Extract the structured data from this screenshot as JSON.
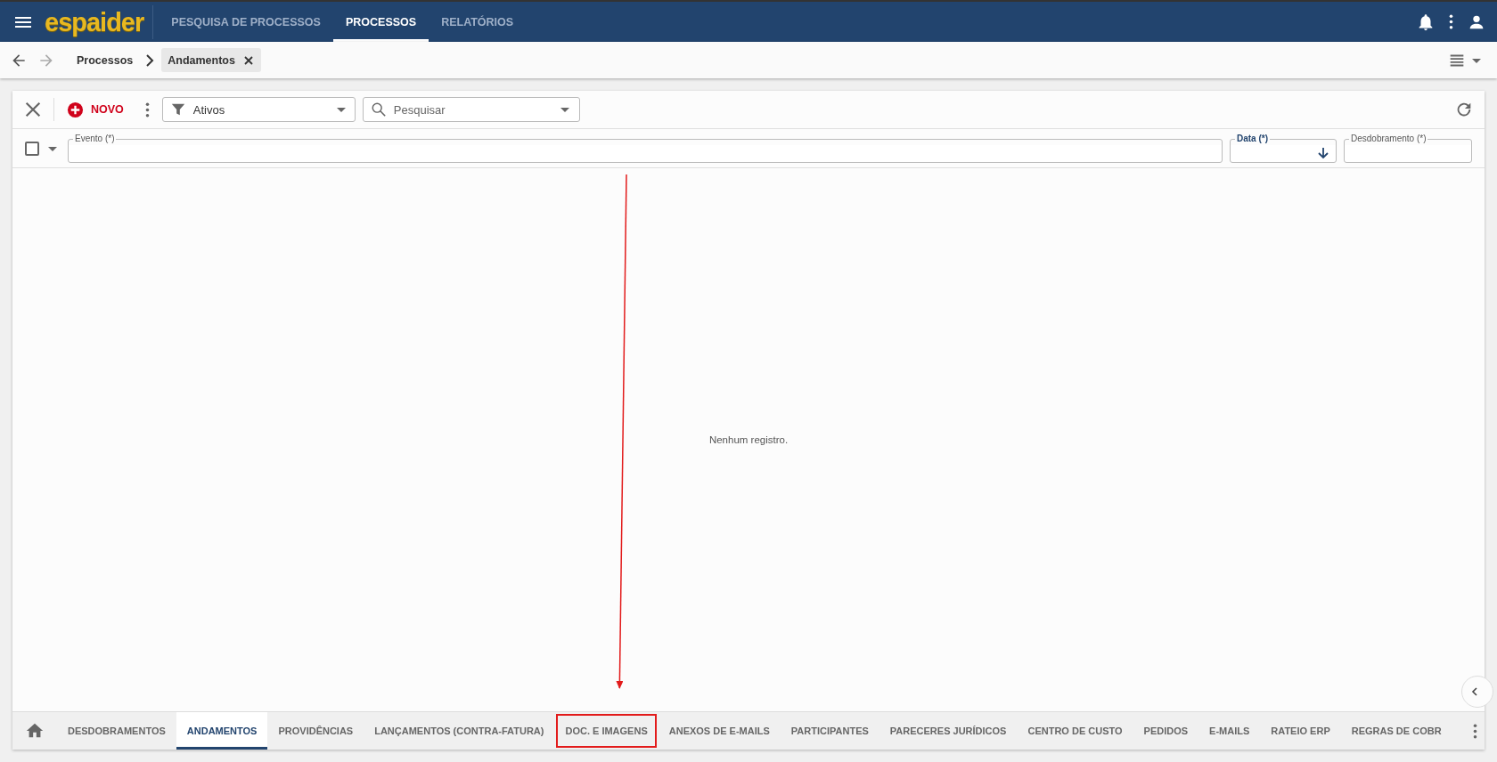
{
  "app": {
    "logo": "espaider"
  },
  "nav": [
    {
      "label": "PESQUISA DE PROCESSOS",
      "selected": false
    },
    {
      "label": "PROCESSOS",
      "selected": true
    },
    {
      "label": "RELATÓRIOS",
      "selected": false
    }
  ],
  "breadcrumb": {
    "root": "Processos",
    "current": "Andamentos"
  },
  "toolbar": {
    "new_label": "NOVO",
    "filter": "Ativos",
    "search": {
      "placeholder": "Pesquisar"
    }
  },
  "grid": {
    "select_all": {
      "checked": false
    },
    "columns": [
      {
        "label": "Evento (*)",
        "sorted": false
      },
      {
        "label": "Data (*)",
        "sorted": true
      },
      {
        "label": "Desdobramento (*)",
        "sorted": false
      }
    ],
    "empty_message": "Nenhum registro."
  },
  "tabs": [
    {
      "label": "DESDOBRAMENTOS",
      "selected": false,
      "highlighted": false
    },
    {
      "label": "ANDAMENTOS",
      "selected": true,
      "highlighted": false
    },
    {
      "label": "PROVIDÊNCIAS",
      "selected": false,
      "highlighted": false
    },
    {
      "label": "LANÇAMENTOS (CONTRA-FATURA)",
      "selected": false,
      "highlighted": false
    },
    {
      "label": "DOC. E IMAGENS",
      "selected": false,
      "highlighted": true
    },
    {
      "label": "ANEXOS DE E-MAILS",
      "selected": false,
      "highlighted": false
    },
    {
      "label": "PARTICIPANTES",
      "selected": false,
      "highlighted": false
    },
    {
      "label": "PARECERES JURÍDICOS",
      "selected": false,
      "highlighted": false
    },
    {
      "label": "CENTRO DE CUSTO",
      "selected": false,
      "highlighted": false
    },
    {
      "label": "PEDIDOS",
      "selected": false,
      "highlighted": false
    },
    {
      "label": "E-MAILS",
      "selected": false,
      "highlighted": false
    },
    {
      "label": "RATEIO ERP",
      "selected": false,
      "highlighted": false
    },
    {
      "label": "REGRAS DE COBR",
      "selected": false,
      "highlighted": false
    }
  ]
}
